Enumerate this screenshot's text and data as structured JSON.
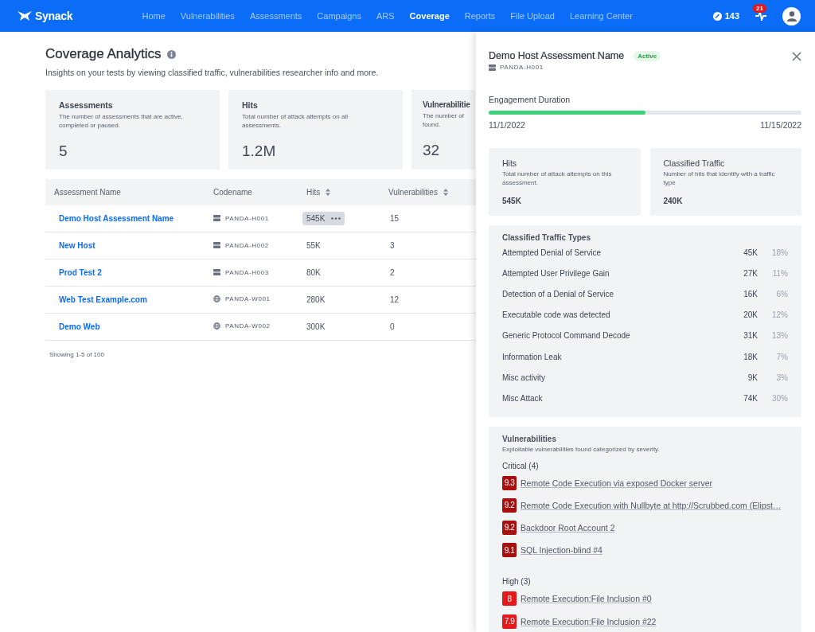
{
  "nav": {
    "logo": "Synack",
    "items": [
      {
        "label": "Home",
        "selected": false
      },
      {
        "label": "Vulnerabilities",
        "selected": false
      },
      {
        "label": "Assessments",
        "selected": false
      },
      {
        "label": "Campaigns",
        "selected": false
      },
      {
        "label": "ARS",
        "selected": false
      },
      {
        "label": "Coverage",
        "selected": true
      },
      {
        "label": "Reports",
        "selected": false
      },
      {
        "label": "File Upload",
        "selected": false
      },
      {
        "label": "Learning Center",
        "selected": false
      }
    ],
    "points": "143",
    "notification_count": "21"
  },
  "page": {
    "title": "Coverage Analytics",
    "subtitle": "Insights on your tests by viewing classified traffic, vulnerabilities researcher info and more."
  },
  "stat_cards": [
    {
      "title": "Assessments",
      "description": "The number of assessments that are active, completed or paused.",
      "value": "5"
    },
    {
      "title": "Hits",
      "description": "Total number of attack attempts on all assessments.",
      "value": "1.2M"
    },
    {
      "title": "Vulnerabilitie",
      "description": "The number of found.",
      "value": "32"
    }
  ],
  "table": {
    "columns": [
      {
        "label": "Assessment Name",
        "sortable": false
      },
      {
        "label": "Codename",
        "sortable": false
      },
      {
        "label": "Hits",
        "sortable": true
      },
      {
        "label": "Vulnerabilities",
        "sortable": true
      }
    ],
    "rows": [
      {
        "name": "Demo Host Assessment Name",
        "kind": "host",
        "codename": "PANDA-H001",
        "hits": "545K",
        "selected": true,
        "vulnerabilities": "15"
      },
      {
        "name": "New Host",
        "kind": "host",
        "codename": "PANDA-H002",
        "hits": "55K",
        "selected": false,
        "vulnerabilities": "3"
      },
      {
        "name": "Prod Test 2",
        "kind": "host",
        "codename": "PANDA-H003",
        "hits": "80K",
        "selected": false,
        "vulnerabilities": "2"
      },
      {
        "name": "Web Test Example.com",
        "kind": "web",
        "codename": "PANDA-W001",
        "hits": "280K",
        "selected": false,
        "vulnerabilities": "12"
      },
      {
        "name": "Demo Web",
        "kind": "web",
        "codename": "PANDA-W002",
        "hits": "300K",
        "selected": false,
        "vulnerabilities": "0"
      }
    ],
    "footer": "Showing 1-5 of 100"
  },
  "drawer": {
    "title": "Demo Host Assessment Name",
    "status": "Active",
    "kind": "host",
    "codename": "PANDA-H001",
    "duration": {
      "label": "Engagement Duration",
      "level": 0.5,
      "start": "11/1/2022",
      "end": "11/15/2022"
    },
    "cards": [
      {
        "title": "Hits",
        "description": "Total number of attack attempts on this assessment.",
        "value": "545K"
      },
      {
        "title": "Classified Traffic",
        "description": "Number of hits that identify with a traffic type",
        "value": "240K"
      }
    ],
    "traffic": {
      "title": "Classified Traffic Types",
      "rows": [
        {
          "name": "Attempted Denial of Service",
          "count": "45K",
          "percent": "18%"
        },
        {
          "name": "Attempted User Privilege Gain",
          "count": "27K",
          "percent": "11%"
        },
        {
          "name": "Detection of a Denial of Service",
          "count": "16K",
          "percent": "6%"
        },
        {
          "name": "Executable code was detected",
          "count": "20K",
          "percent": "12%"
        },
        {
          "name": "Generic Protocol Command Decode",
          "count": "31K",
          "percent": "13%"
        },
        {
          "name": "Information Leak",
          "count": "18K",
          "percent": "7%"
        },
        {
          "name": "Misc activity",
          "count": "9K",
          "percent": "3%"
        },
        {
          "name": "Misc Attack",
          "count": "74K",
          "percent": "30%"
        }
      ]
    },
    "vulnerabilities": {
      "title": "Vulnerabilities",
      "description": "Exploitable vulnerabilities found categorized by severity.",
      "groups": [
        {
          "label": "Critical (4)",
          "items": [
            {
              "score": "9.3",
              "title": "Remote Code Execution via exposed Docker server",
              "color": "#a80f0f"
            },
            {
              "score": "9.2",
              "title": "Remote Code Execution with Nullbyte at http://Scrubbed.com (Elipst…",
              "color": "#a80f0f"
            },
            {
              "score": "9.2",
              "title": "Backdoor Root Account 2",
              "color": "#a80f0f"
            },
            {
              "score": "9.1",
              "title": "SQL Injection-blind #4",
              "color": "#a80f0f"
            }
          ]
        },
        {
          "label": "High (3)",
          "items": [
            {
              "score": "8",
              "title": "Remote Execution:File Inclusion #0",
              "color": "#e3191c"
            },
            {
              "score": "7.9",
              "title": "Remote Execution:File Inclusion #22",
              "color": "#e3191c"
            }
          ]
        }
      ]
    }
  }
}
